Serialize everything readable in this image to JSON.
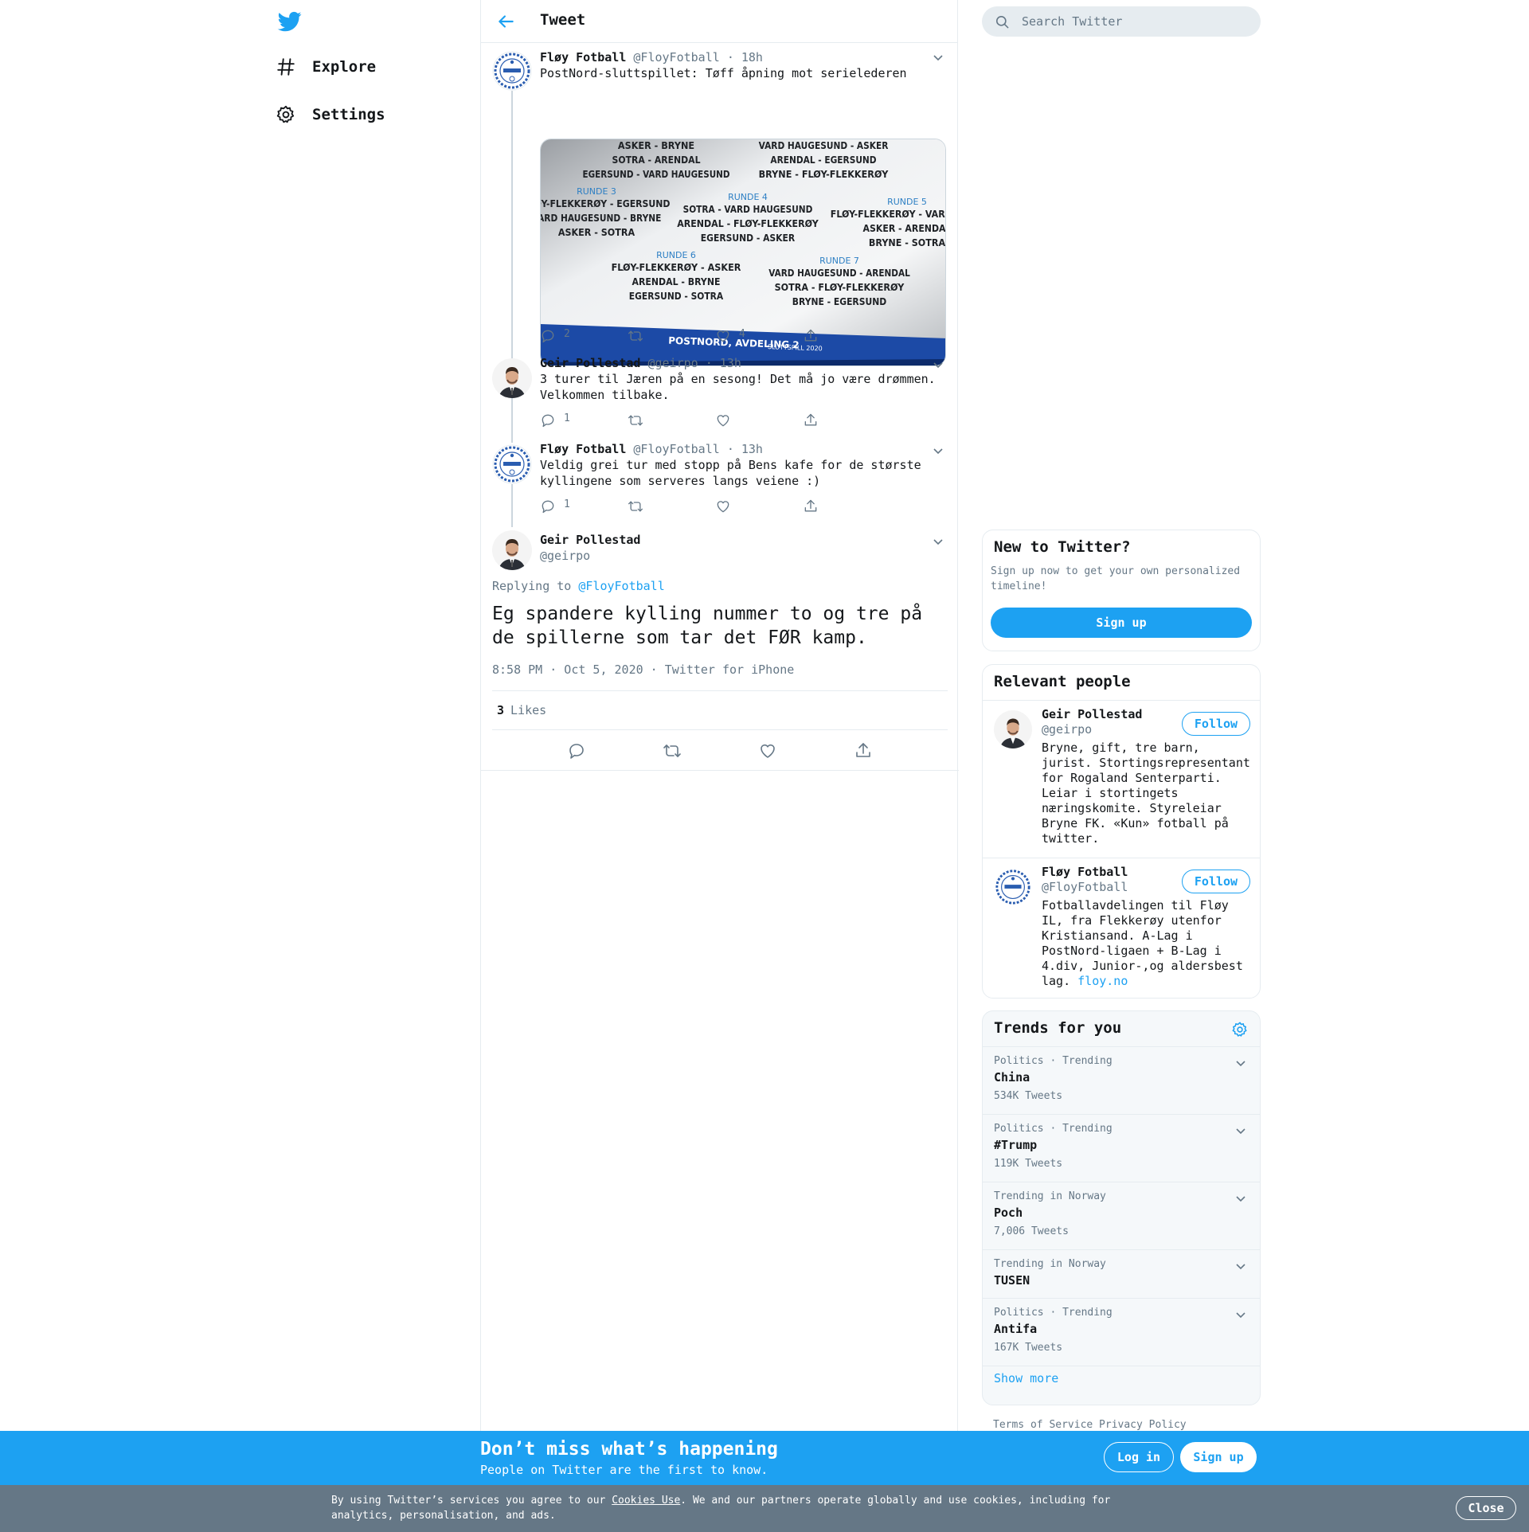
{
  "nav": {
    "explore_label": "Explore",
    "settings_label": "Settings"
  },
  "header": {
    "title": "Tweet"
  },
  "tweets": [
    {
      "name": "Fløy Fotball",
      "handle": "@FloyFotball",
      "time": "· 18h",
      "text": "PostNord-sluttspillet: Tøff åpning mot serielederen",
      "replies": "2",
      "retweets": "",
      "likes": "4"
    },
    {
      "name": "Geir Pollestad",
      "handle": "@geirpo",
      "time": "· 13h",
      "text": "3 turer til Jæren på en sesong! Det må jo være drømmen.\nVelkommen tilbake.",
      "replies": "1",
      "retweets": "",
      "likes": ""
    },
    {
      "name": "Fløy Fotball",
      "handle": "@FloyFotball",
      "time": "· 13h",
      "text": "Veldig grei tur med stopp på Bens kafe for de største\nkyllingene som serveres langs veiene :)",
      "replies": "1",
      "retweets": "",
      "likes": ""
    }
  ],
  "media": {
    "rounds": [
      {
        "title": "",
        "lines": [
          "ASKER - BRYNE",
          "SOTRA - ARENDAL",
          "EGERSUND - VARD HAUGESUND"
        ]
      },
      {
        "title": "",
        "lines": [
          "VARD HAUGESUND - ASKER",
          "ARENDAL - EGERSUND",
          "BRYNE - FLØY-FLEKKERØY"
        ]
      },
      {
        "title": "RUNDE 3",
        "lines": [
          "FLØY-FLEKKERØY - EGERSUND",
          "VARD HAUGESUND - BRYNE",
          "ASKER - SOTRA"
        ]
      },
      {
        "title": "RUNDE 4",
        "lines": [
          "SOTRA - VARD HAUGESUND",
          "ARENDAL - FLØY-FLEKKERØY",
          "EGERSUND - ASKER"
        ]
      },
      {
        "title": "RUNDE 5",
        "lines": [
          "FLØY-FLEKKERØY - VARD HAUG",
          "ASKER - ARENDAL",
          "BRYNE - SOTRA"
        ]
      },
      {
        "title": "RUNDE 6",
        "lines": [
          "FLØY-FLEKKERØY - ASKER",
          "ARENDAL - BRYNE",
          "EGERSUND - SOTRA"
        ]
      },
      {
        "title": "RUNDE 7",
        "lines": [
          "VARD HAUGESUND - ARENDAL",
          "SOTRA - FLØY-FLEKKERØY",
          "BRYNE - EGERSUND"
        ]
      }
    ],
    "banner": "POSTNORD, AVDELING 2",
    "banner_small": "SLUTTSPILL 2020"
  },
  "focused": {
    "name": "Geir Pollestad",
    "handle": "@geirpo",
    "replying_prefix": "Replying to",
    "replying_to": "@FloyFotball",
    "text": "Eg spandere kylling nummer to og tre på de spillerne som tar det FØR kamp.",
    "meta": "8:58 PM · Oct 5, 2020 · Twitter for iPhone",
    "likes_count": "3",
    "likes_label": "Likes"
  },
  "search": {
    "placeholder": "Search Twitter"
  },
  "new_to_twitter": {
    "title": "New to Twitter?",
    "desc": "Sign up now to get your own personalized timeline!",
    "button": "Sign up"
  },
  "relevant_people": {
    "title": "Relevant people",
    "follow_label": "Follow",
    "people": [
      {
        "name": "Geir Pollestad",
        "handle": "@geirpo",
        "bio": "Bryne, gift, tre barn, jurist. Stortingsrepresentant for Rogaland Senterparti. Leiar i stortingets næringskomite. Styreleiar Bryne FK. «Kun» fotball på twitter."
      },
      {
        "name": "Fløy Fotball",
        "handle": "@FloyFotball",
        "bio": "Fotballavdelingen til Fløy IL, fra Flekkerøy utenfor Kristiansand. A-Lag i PostNord-ligaen + B-Lag i 4.div, Junior-,og aldersbest lag.",
        "link": "floy.no"
      }
    ]
  },
  "trends": {
    "title": "Trends for you",
    "items": [
      {
        "category": "Politics · Trending",
        "name": "China",
        "count": "534K Tweets"
      },
      {
        "category": "Politics · Trending",
        "name": "#Trump",
        "count": "119K Tweets"
      },
      {
        "category": "Trending in Norway",
        "name": "Poch",
        "count": "7,006 Tweets"
      },
      {
        "category": "Trending in Norway",
        "name": "TUSEN",
        "count": ""
      },
      {
        "category": "Politics · Trending",
        "name": "Antifa",
        "count": "167K Tweets"
      }
    ],
    "show_more": "Show more"
  },
  "footer": {
    "links": "Terms of Service Privacy Policy"
  },
  "bottom_bar": {
    "title": "Don’t miss what’s happening",
    "subtitle": "People on Twitter are the first to know.",
    "login": "Log in",
    "signup": "Sign up"
  },
  "cookie": {
    "before": "By using Twitter’s services you agree to our ",
    "link": "Cookies Use",
    "after": ". We and our partners operate globally and use cookies, including for analytics, personalisation, and ads.",
    "close": "Close"
  },
  "colors": {
    "accent": "#1da1f2",
    "text": "#14171a",
    "secondary": "#657786",
    "border": "#e6ecf0"
  }
}
